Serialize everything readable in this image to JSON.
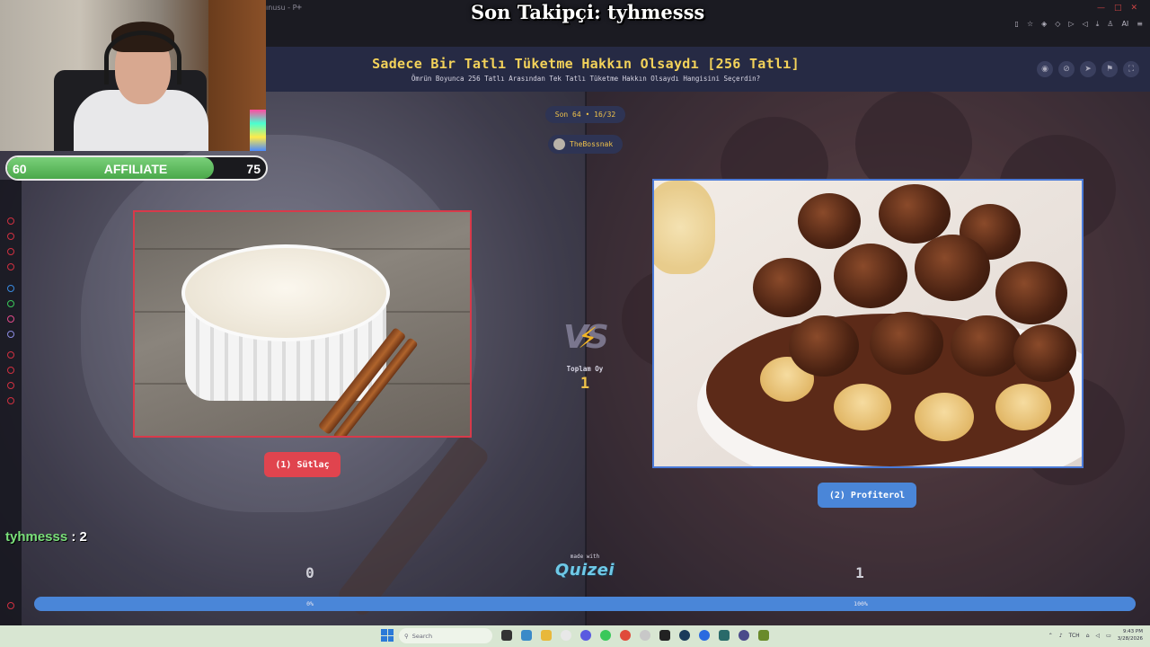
{
  "browser": {
    "tab_label": "ınusu - P",
    "new_tab": "+",
    "window_controls": [
      "∅",
      "—",
      "□",
      "✕"
    ],
    "toolbar_icons": [
      "bookmark-icon",
      "bookmark-star-icon",
      "shield-icon",
      "extension-icon",
      "play-icon",
      "sound-icon",
      "download-icon",
      "person-icon",
      "ai-icon",
      "menu-icon"
    ],
    "ai_label": "AI"
  },
  "overlay": {
    "follower_banner": "Son Takipçi: tyhmesss",
    "affiliate": {
      "current": "60",
      "label": "AFFILIATE",
      "goal": "75",
      "progress_fraction": 0.8
    },
    "chat": {
      "user": "tyhmesss",
      "message": " : 2"
    }
  },
  "quiz": {
    "title": "Sadece Bir Tatlı Tüketme Hakkın Olsaydı [256 Tatlı]",
    "subtitle": "Ömrün Boyunca 256 Tatlı Arasından Tek Tatlı Tüketme Hakkın Olsaydı Hangisini Seçerdin?",
    "header_icons": [
      "eye-icon",
      "link-icon",
      "share-icon",
      "flag-icon",
      "fullscreen-icon"
    ],
    "round": "Son 64 • 16/32",
    "player": "TheBossnak",
    "vs": "VS",
    "total_label": "Toplam Oy",
    "total_value": "1",
    "made_with": "made with",
    "brand": "Quizei",
    "choices": [
      {
        "button": "(1) Sütlaç",
        "votes": "0",
        "percent_label": "0%",
        "percent": 0,
        "accent": "#e0444e"
      },
      {
        "button": "(2) Profiterol",
        "votes": "1",
        "percent_label": "100%",
        "percent": 100,
        "accent": "#4a86d8"
      }
    ]
  },
  "taskbar": {
    "search_placeholder": "Search",
    "tray_lang": "TCH",
    "time": "9:43 PM",
    "date": "3/28/2026"
  }
}
